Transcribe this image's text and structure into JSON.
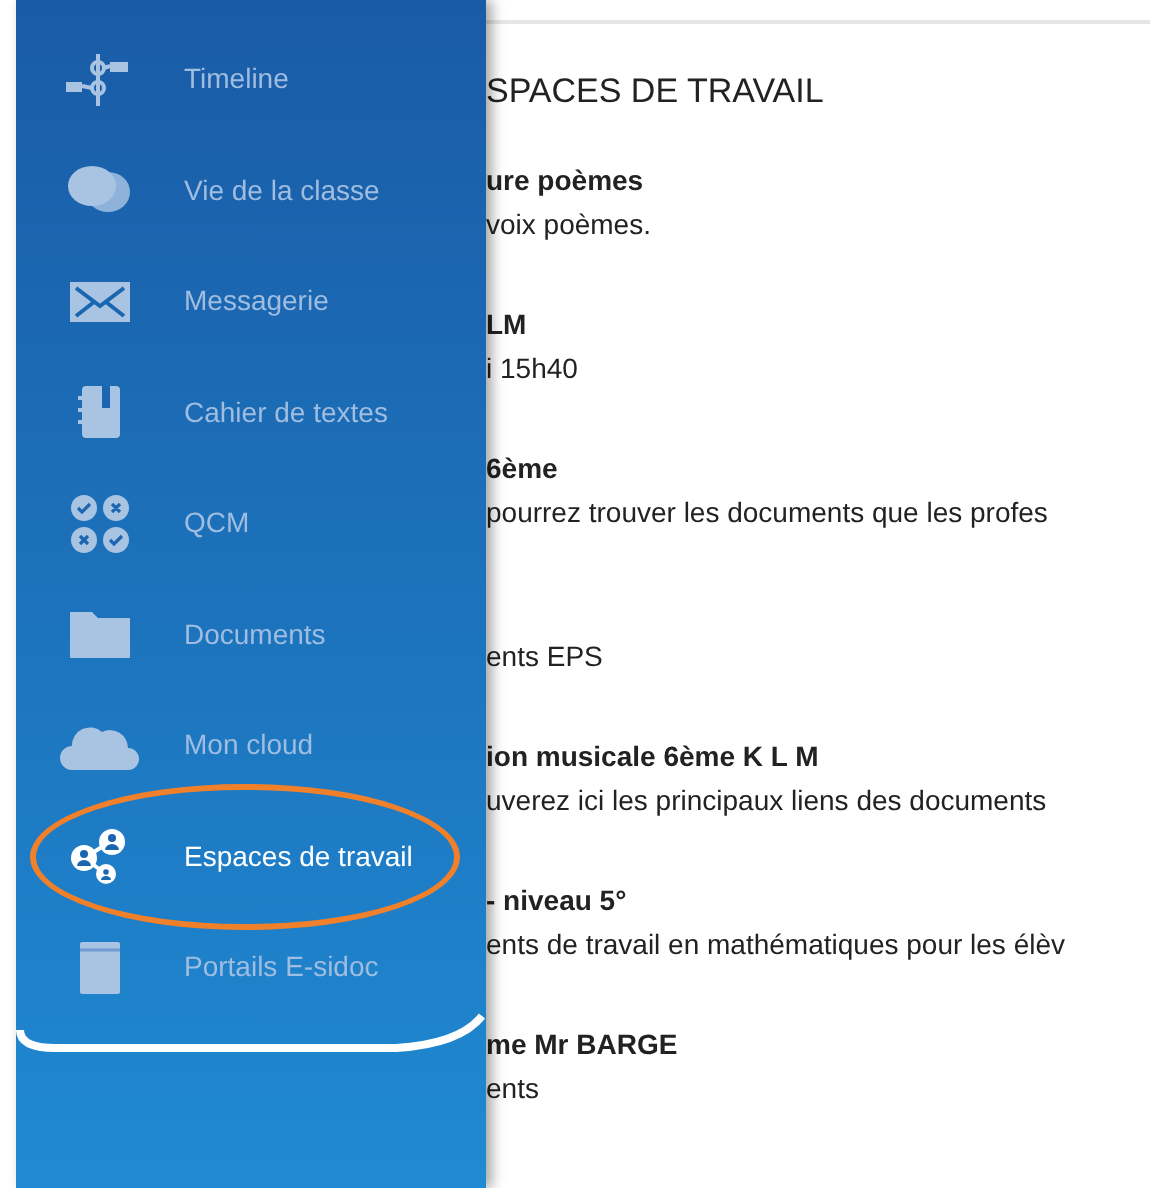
{
  "sidebar": {
    "items": [
      {
        "label": "Timeline",
        "selected": false
      },
      {
        "label": "Vie de la classe",
        "selected": false
      },
      {
        "label": "Messagerie",
        "selected": false
      },
      {
        "label": "Cahier de textes",
        "selected": false
      },
      {
        "label": "QCM",
        "selected": false
      },
      {
        "label": "Documents",
        "selected": false
      },
      {
        "label": "Mon cloud",
        "selected": false
      },
      {
        "label": "Espaces de travail",
        "selected": true
      },
      {
        "label": "Portails E-sidoc",
        "selected": false
      }
    ]
  },
  "content": {
    "heading": "SPACES DE TRAVAIL",
    "entries": [
      {
        "title": "ure poèmes",
        "description": "voix poèmes."
      },
      {
        "title": "LM",
        "description": "i 15h40"
      },
      {
        "title": "6ème",
        "description": "pourrez trouver les documents que les profes"
      },
      {
        "description": "ents EPS"
      },
      {
        "title": "ion musicale 6ème K L M",
        "description": "uverez ici les principaux liens des documents"
      },
      {
        "title": "- niveau 5°",
        "description": "ents de travail en mathématiques pour les élèv"
      },
      {
        "title": "me Mr BARGE",
        "description": "ents"
      }
    ]
  }
}
